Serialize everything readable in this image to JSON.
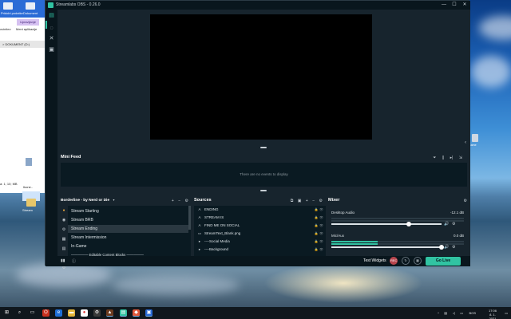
{
  "window": {
    "title": "Streamlabs OBS - 0.26.0",
    "minimize": "—",
    "maximize": "☐",
    "close": "✕"
  },
  "colors": {
    "accent": "#31c3a2",
    "panel": "#17242d",
    "dark": "#09161d",
    "list_bg": "#0a1a22",
    "record": "#b8454d"
  },
  "mini_feed": {
    "title": "Mini Feed",
    "empty_text": "There are no events to display"
  },
  "scenes": {
    "collection": "Borderline - by Nerd or Die",
    "selected": "Stream Ending",
    "items": [
      "Stream Starting",
      "Stream BRB",
      "Stream Ending",
      "Stream Intermission",
      "In-Game",
      "――――― Editable Content Blocks ―――――"
    ]
  },
  "sources": {
    "title": "Sources",
    "items": [
      {
        "label": "ENDING",
        "icon": "text-icon"
      },
      {
        "label": "STREAM IS",
        "icon": "text-icon"
      },
      {
        "label": "FIND ME ON SOCIAL",
        "icon": "text-icon"
      },
      {
        "label": "StreamText_Blank.png",
        "icon": "image-icon"
      },
      {
        "label": "----Social Media",
        "icon": "folder-icon"
      },
      {
        "label": "----Background",
        "icon": "folder-icon"
      }
    ]
  },
  "mixer": {
    "title": "Mixer",
    "channels": [
      {
        "name": "Desktop Audio",
        "db": "-12.1 dB",
        "volume": 0.7,
        "level": 0
      },
      {
        "name": "Mic/Aux",
        "db": "0.0 dB",
        "volume": 1.0,
        "level": 0.35
      }
    ]
  },
  "footer": {
    "test_widgets": "Test Widgets",
    "rec_label": "REC",
    "go_live": "Go Live"
  },
  "background_app": {
    "toolbar_labels": [
      "Pridobi podatke",
      "Dokument"
    ],
    "button": "Upravljanje",
    "lines": [
      "ovinitev",
      "Vstavi",
      "Meni aplikacije",
      "> DOKUMENT (D:)",
      "Stream",
      "a: 1; 10; MB",
      "StreamBox..",
      "Ikone..",
      "Stream Mode.."
    ],
    "folder_label": "Stream",
    "right_icon_label": "Game"
  },
  "taskbar": {
    "language": "BOS",
    "time": "17:06",
    "date": "8. 1. 2021"
  }
}
